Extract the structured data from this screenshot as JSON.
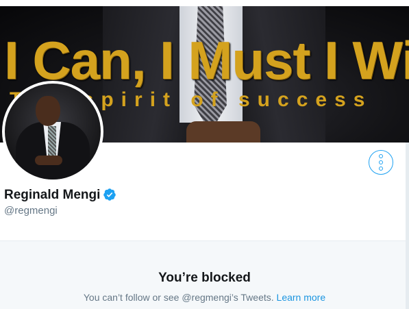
{
  "banner": {
    "headline": "I Can, I Must I Will",
    "subline": "The spirit of success"
  },
  "profile": {
    "name": "Reginald Mengi",
    "handle": "@regmengi",
    "verified": true
  },
  "icons": {
    "verified": "verified-badge-icon",
    "more": "more-options-icon"
  },
  "blocked": {
    "title": "You’re blocked",
    "message": "You can’t follow or see @regmengi’s Tweets.",
    "link": "Learn more"
  },
  "colors": {
    "accent": "#1da1f2",
    "link": "#1b95e0",
    "banner_text": "#d4a21e",
    "muted": "#657786",
    "panel_bg": "#f5f8fa"
  }
}
